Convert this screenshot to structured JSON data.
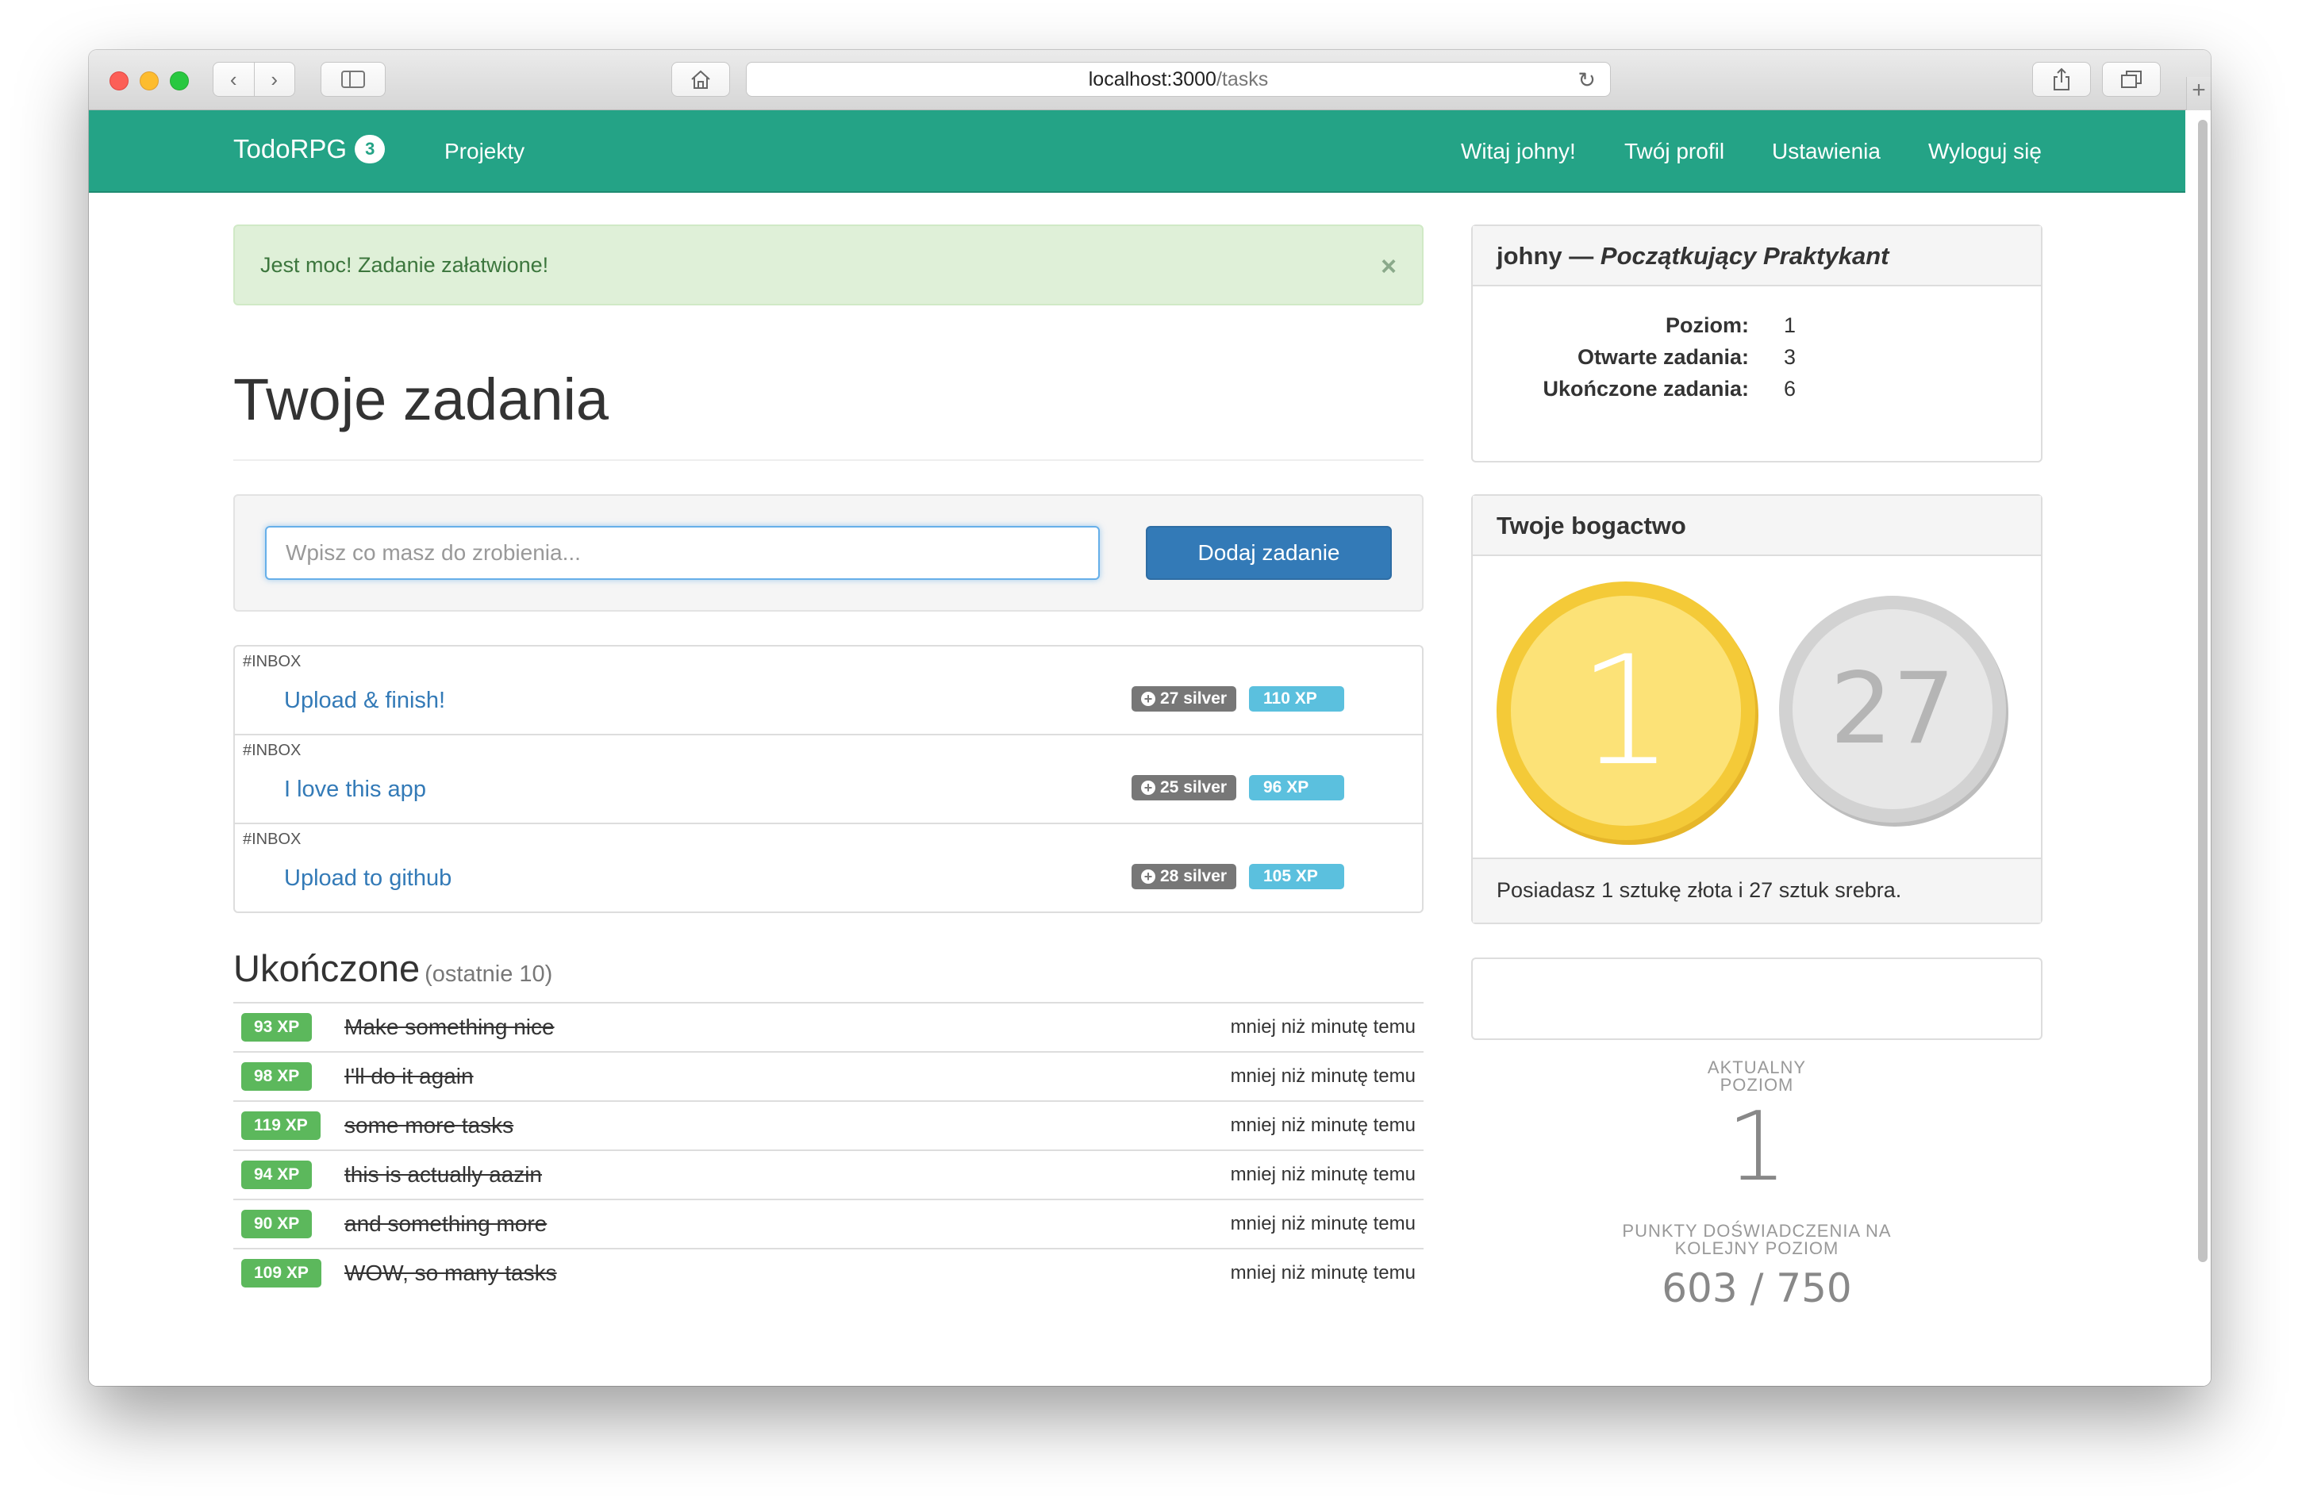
{
  "browser": {
    "url_host": "localhost:3000",
    "url_path": "/tasks"
  },
  "navbar": {
    "brand": "TodoRPG",
    "badge": "3",
    "projects": "Projekty",
    "greeting": "Witaj johny!",
    "profile": "Twój profil",
    "settings": "Ustawienia",
    "logout": "Wyloguj się"
  },
  "alert": {
    "message": "Jest moc! Zadanie załatwione!",
    "close": "×"
  },
  "main": {
    "title": "Twoje zadania",
    "input_placeholder": "Wpisz co masz do zrobienia...",
    "add_button": "Dodaj zadanie"
  },
  "tasks": [
    {
      "project": "#INBOX",
      "title": "Upload & finish!",
      "silver": "27 silver",
      "xp": "110 XP"
    },
    {
      "project": "#INBOX",
      "title": "I love this app",
      "silver": "25 silver",
      "xp": "96 XP"
    },
    {
      "project": "#INBOX",
      "title": "Upload to github",
      "silver": "28 silver",
      "xp": "105 XP"
    }
  ],
  "completed": {
    "heading": "Ukończone",
    "subheading": "(ostatnie 10)",
    "items": [
      {
        "xp": "93 XP",
        "title": "Make something nice",
        "time": "mniej niż minutę temu"
      },
      {
        "xp": "98 XP",
        "title": "I'll do it again",
        "time": "mniej niż minutę temu"
      },
      {
        "xp": "119 XP",
        "title": "some more tasks",
        "time": "mniej niż minutę temu"
      },
      {
        "xp": "94 XP",
        "title": "this is actually aazin",
        "time": "mniej niż minutę temu"
      },
      {
        "xp": "90 XP",
        "title": "and something more",
        "time": "mniej niż minutę temu"
      },
      {
        "xp": "109 XP",
        "title": "WOW, so many tasks",
        "time": "mniej niż minutę temu"
      }
    ]
  },
  "profile": {
    "name": "johny —",
    "rank": "Początkujący Praktykant",
    "stats": [
      {
        "label": "Poziom:",
        "value": "1"
      },
      {
        "label": "Otwarte zadania:",
        "value": "3"
      },
      {
        "label": "Ukończone zadania:",
        "value": "6"
      }
    ]
  },
  "wealth": {
    "heading": "Twoje bogactwo",
    "gold": "1",
    "silver": "27",
    "summary": "Posiadasz 1 sztukę złota i 27 sztuk srebra."
  },
  "level": {
    "caption_line1": "AKTUALNY",
    "caption_line2": "POZIOM",
    "value": "1",
    "xp_caption_line1": "PUNKTY DOŚWIADCZENIA NA",
    "xp_caption_line2": "KOLEJNY POZIOM",
    "xp_value": "603 / 750"
  },
  "colors": {
    "navbar": "#24a386",
    "primary": "#337ab7",
    "success": "#5cb85c",
    "info": "#5bc0de",
    "gold": "#f4ca38",
    "silver": "#d2d2d2"
  }
}
